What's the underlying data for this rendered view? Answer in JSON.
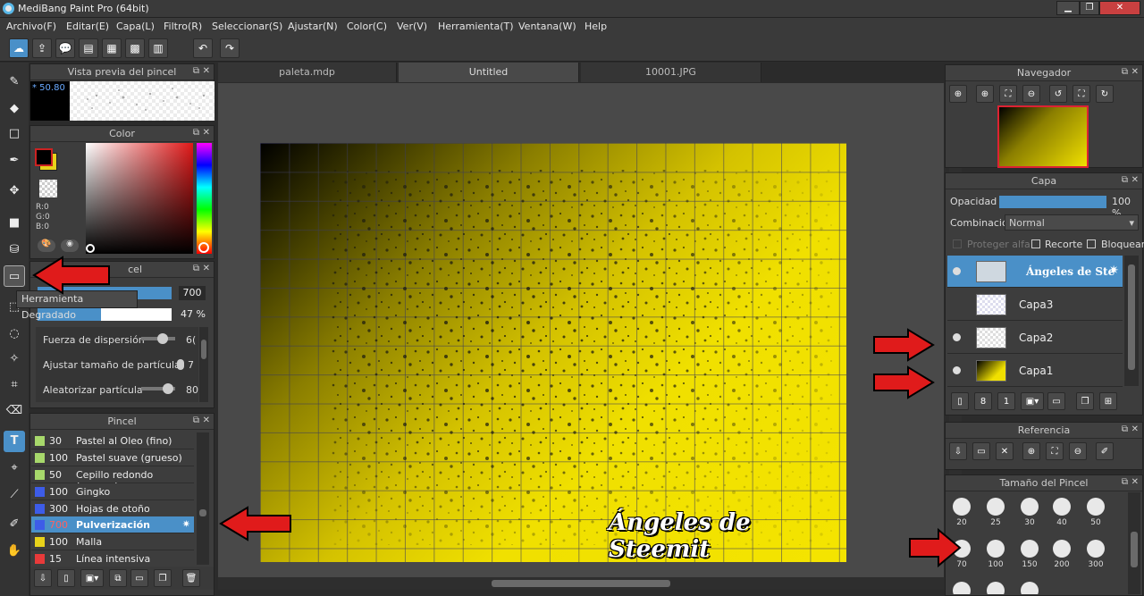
{
  "window": {
    "title": "MediBang Paint Pro (64bit)"
  },
  "menu": [
    "Archivo(F)",
    "Editar(E)",
    "Capa(L)",
    "Filtro(R)",
    "Seleccionar(S)",
    "Ajustar(N)",
    "Color(C)",
    "Ver(V)",
    "Herramienta(T)",
    "Ventana(W)",
    "Help"
  ],
  "tabs": [
    "paleta.mdp",
    "Untitled",
    "10001.JPG"
  ],
  "brush_preview": {
    "title": "Vista previa del pincel",
    "size": "* 50.80"
  },
  "color_panel": {
    "title": "Color",
    "r": "R:0",
    "g": "G:0",
    "b": "B:0"
  },
  "brush_settings": {
    "title_partial": "cel",
    "tooltip": "Herramienta Degradado",
    "size_value": "700",
    "opacity_value": "47 %",
    "params": [
      {
        "label": "Fuerza de dispersión",
        "value": "6("
      },
      {
        "label": "Ajustar tamaño de partícula",
        "value": "7"
      },
      {
        "label": "Aleatorizar partícula",
        "value": "80"
      }
    ]
  },
  "brush_list": {
    "title": "Pincel",
    "items": [
      {
        "size": "30",
        "name": "Pastel al Oleo (fino)",
        "color": "#a7d86b"
      },
      {
        "size": "100",
        "name": "Pastel suave (grueso)",
        "color": "#a7d86b"
      },
      {
        "size": "50",
        "name": "Cepillo redondo (acuoso)",
        "color": "#a7d86b"
      },
      {
        "size": "100",
        "name": "Gingko",
        "color": "#3d5ce8"
      },
      {
        "size": "300",
        "name": "Hojas de otoño",
        "color": "#3d5ce8"
      },
      {
        "size": "700",
        "name": "Pulverización",
        "color": "#3d5ce8",
        "selected": true
      },
      {
        "size": "100",
        "name": "Malla",
        "color": "#e8d21a"
      },
      {
        "size": "15",
        "name": "Línea intensiva",
        "color": "#e83a3a"
      }
    ]
  },
  "canvas": {
    "watermark": "Ángeles de Steemit"
  },
  "navigator": {
    "title": "Navegador"
  },
  "layers": {
    "title": "Capa",
    "opacity_label": "Opacidad",
    "opacity_value": "100 %",
    "blend_label": "Combinación",
    "blend_value": "Normal",
    "protect_alpha": "Proteger alfa",
    "clip": "Recorte",
    "lock": "Bloquear",
    "items": [
      {
        "name": "Ángeles de Ste",
        "selected": true
      },
      {
        "name": "Capa3"
      },
      {
        "name": "Capa2"
      },
      {
        "name": "Capa1"
      }
    ]
  },
  "reference": {
    "title": "Referencia"
  },
  "brush_size": {
    "title": "Tamaño del Pincel",
    "sizes": [
      "20",
      "25",
      "30",
      "40",
      "50",
      "70",
      "100",
      "150",
      "200",
      "300"
    ]
  },
  "colors": {
    "accent": "#4a90c8",
    "arrow": "#e01b1b",
    "canvas_yellow": "#f0e000"
  }
}
